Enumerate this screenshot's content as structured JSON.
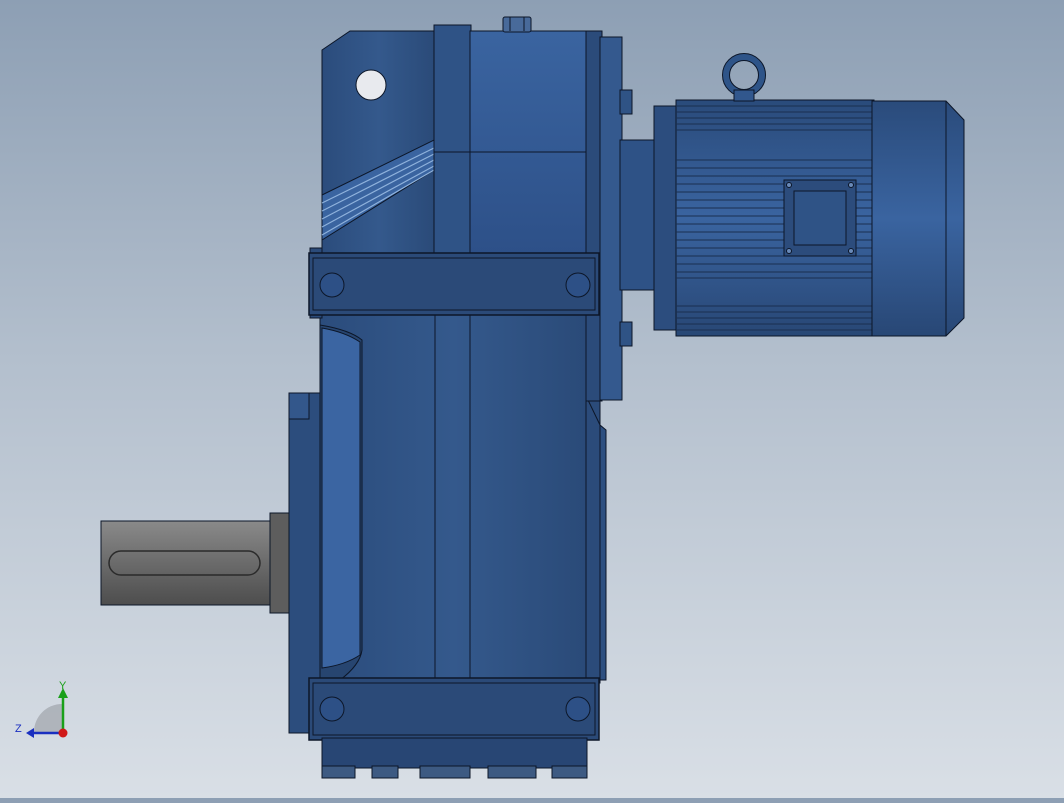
{
  "viewport": {
    "background_top": "#8d9fb4",
    "background_bottom": "#d9dfe6"
  },
  "model": {
    "body_color": "#2f5487",
    "edge_color": "#0c1628",
    "shaft_color": "#6a6a6a"
  },
  "triad": {
    "y_label": "Y",
    "z_label": "Z",
    "y_color": "#1aa01a",
    "z_color": "#1a2fc0",
    "x_color": "#d01818"
  }
}
